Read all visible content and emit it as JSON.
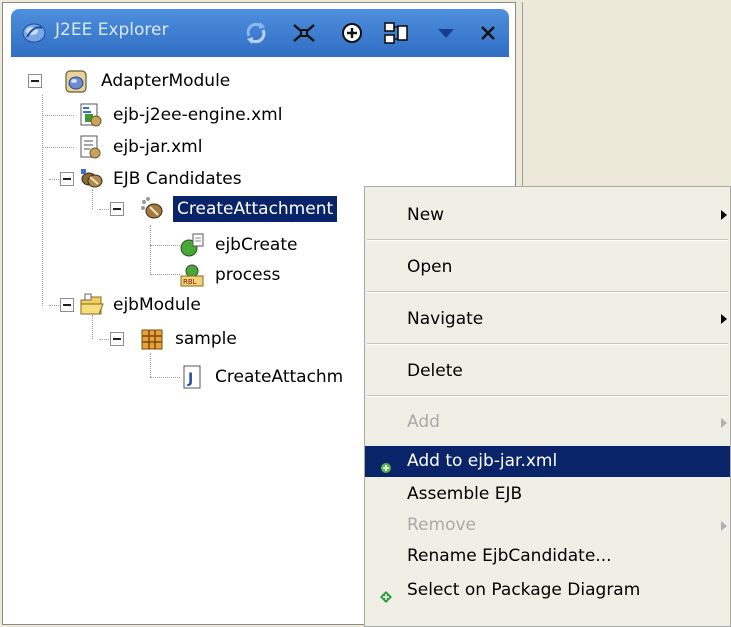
{
  "explorer": {
    "title": "J2EE Explorer",
    "icons": [
      "sync-icon",
      "collapse-all-icon",
      "new-icon",
      "link-icon",
      "view-menu-icon",
      "close-icon"
    ]
  },
  "tree": {
    "adapter_module": "AdapterModule",
    "j2ee_engine_xml": "ejb-j2ee-engine.xml",
    "ejb_jar_xml": "ejb-jar.xml",
    "ejb_candidates": "EJB Candidates",
    "create_attachment": "CreateAttachment",
    "ejb_create": "ejbCreate",
    "process": "process",
    "ejb_module": "ejbModule",
    "sample": "sample",
    "create_attachm_class": "CreateAttachm"
  },
  "context_menu": {
    "items": [
      {
        "label": "New",
        "submenu": true,
        "enabled": true
      },
      {
        "label": "Open",
        "submenu": false,
        "enabled": true
      },
      {
        "label": "Navigate",
        "submenu": true,
        "enabled": true
      },
      {
        "label": "Delete",
        "submenu": false,
        "enabled": true
      },
      {
        "label": "Add",
        "submenu": true,
        "enabled": false
      },
      {
        "label": "Add to ejb-jar.xml",
        "submenu": false,
        "enabled": true,
        "highlighted": true
      },
      {
        "label": "Assemble EJB",
        "submenu": false,
        "enabled": true
      },
      {
        "label": "Remove",
        "submenu": true,
        "enabled": false
      },
      {
        "label": "Rename EjbCandidate...",
        "submenu": false,
        "enabled": true
      },
      {
        "label": "Select on Package Diagram",
        "submenu": false,
        "enabled": true
      }
    ]
  },
  "colors": {
    "selection": "#0a246a",
    "title_bar": "#3b7bd1",
    "menu_background": "#f0efe6",
    "disabled_text": "#a9a9a9"
  }
}
